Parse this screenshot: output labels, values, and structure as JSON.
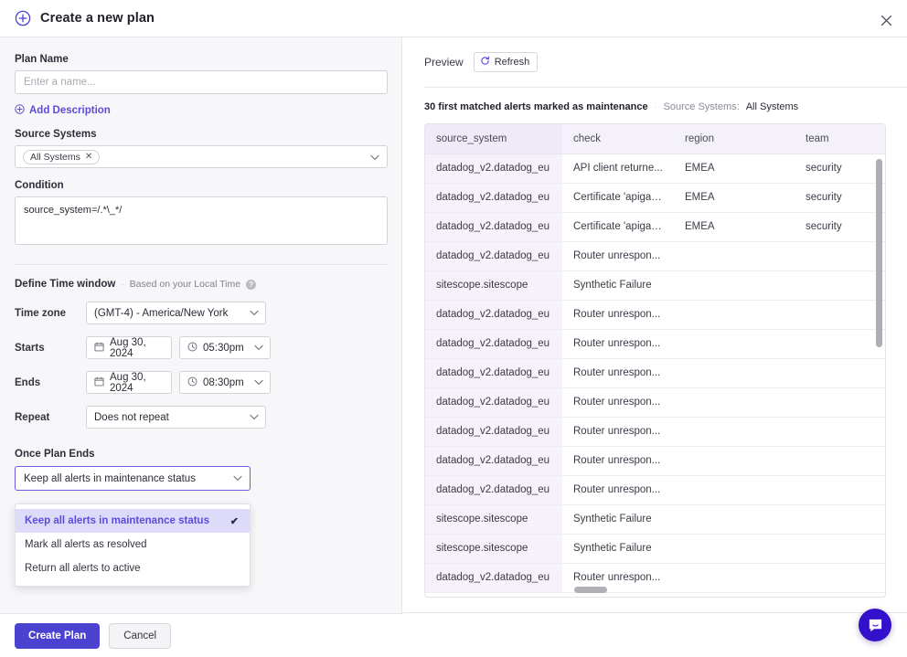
{
  "header": {
    "title": "Create a new plan",
    "plus_icon": "circle-plus-icon",
    "close_icon": "close-icon"
  },
  "form": {
    "plan_name_label": "Plan Name",
    "plan_name_value": "",
    "plan_name_placeholder": "Enter a name...",
    "add_description_label": "Add Description",
    "source_systems_label": "Source Systems",
    "source_systems_chip": "All Systems",
    "condition_label": "Condition",
    "condition_value": "source_system=/.*\\_*/",
    "time_window": {
      "title": "Define Time window",
      "separator": "·",
      "subtitle": "Based on your Local Time",
      "help_glyph": "?",
      "timezone_label": "Time zone",
      "timezone_value": "(GMT-4) - America/New York",
      "starts_label": "Starts",
      "starts_date": "Aug 30, 2024",
      "starts_time": "05:30pm",
      "ends_label": "Ends",
      "ends_date": "Aug 30, 2024",
      "ends_time": "08:30pm",
      "repeat_label": "Repeat",
      "repeat_value": "Does not repeat"
    },
    "once_plan_ends": {
      "label": "Once Plan Ends",
      "selected": "Keep all alerts in maintenance status",
      "options": [
        "Keep all alerts in maintenance status",
        "Mark all alerts as resolved",
        "Return all alerts to active"
      ],
      "selected_index": 0,
      "check_glyph": "✔"
    }
  },
  "preview": {
    "title": "Preview",
    "refresh_label": "Refresh",
    "matched_text": "30 first matched alerts marked as maintenance",
    "separator": "·",
    "source_systems_key": "Source Systems:",
    "source_systems_value": "All Systems",
    "table": {
      "columns": [
        "source_system",
        "check",
        "region",
        "team"
      ],
      "rows": [
        [
          "datadog_v2.datadog_eu",
          "API client returne...",
          "EMEA",
          "security"
        ],
        [
          "datadog_v2.datadog_eu",
          "Certificate 'apigat...",
          "EMEA",
          "security"
        ],
        [
          "datadog_v2.datadog_eu",
          "Certificate 'apigat...",
          "EMEA",
          "security"
        ],
        [
          "datadog_v2.datadog_eu",
          "Router unrespon...",
          "",
          ""
        ],
        [
          "sitescope.sitescope",
          "Synthetic Failure",
          "",
          ""
        ],
        [
          "datadog_v2.datadog_eu",
          "Router unrespon...",
          "",
          ""
        ],
        [
          "datadog_v2.datadog_eu",
          "Router unrespon...",
          "",
          ""
        ],
        [
          "datadog_v2.datadog_eu",
          "Router unrespon...",
          "",
          ""
        ],
        [
          "datadog_v2.datadog_eu",
          "Router unrespon...",
          "",
          ""
        ],
        [
          "datadog_v2.datadog_eu",
          "Router unrespon...",
          "",
          ""
        ],
        [
          "datadog_v2.datadog_eu",
          "Router unrespon...",
          "",
          ""
        ],
        [
          "datadog_v2.datadog_eu",
          "Router unrespon...",
          "",
          ""
        ],
        [
          "sitescope.sitescope",
          "Synthetic Failure",
          "",
          ""
        ],
        [
          "sitescope.sitescope",
          "Synthetic Failure",
          "",
          ""
        ],
        [
          "datadog_v2.datadog_eu",
          "Router unrespon...",
          "",
          ""
        ]
      ]
    }
  },
  "footer": {
    "create_label": "Create Plan",
    "cancel_label": "Cancel"
  },
  "chat": {
    "icon": "chat-bubble-icon"
  },
  "colors": {
    "accent_purple": "#5b4cdb",
    "primary_button": "#4b43cf",
    "chat_bubble": "#3311cc",
    "table_header": "#f4f1fb",
    "first_column": "#f6f1fb",
    "panel_background": "#f7f7f9"
  }
}
